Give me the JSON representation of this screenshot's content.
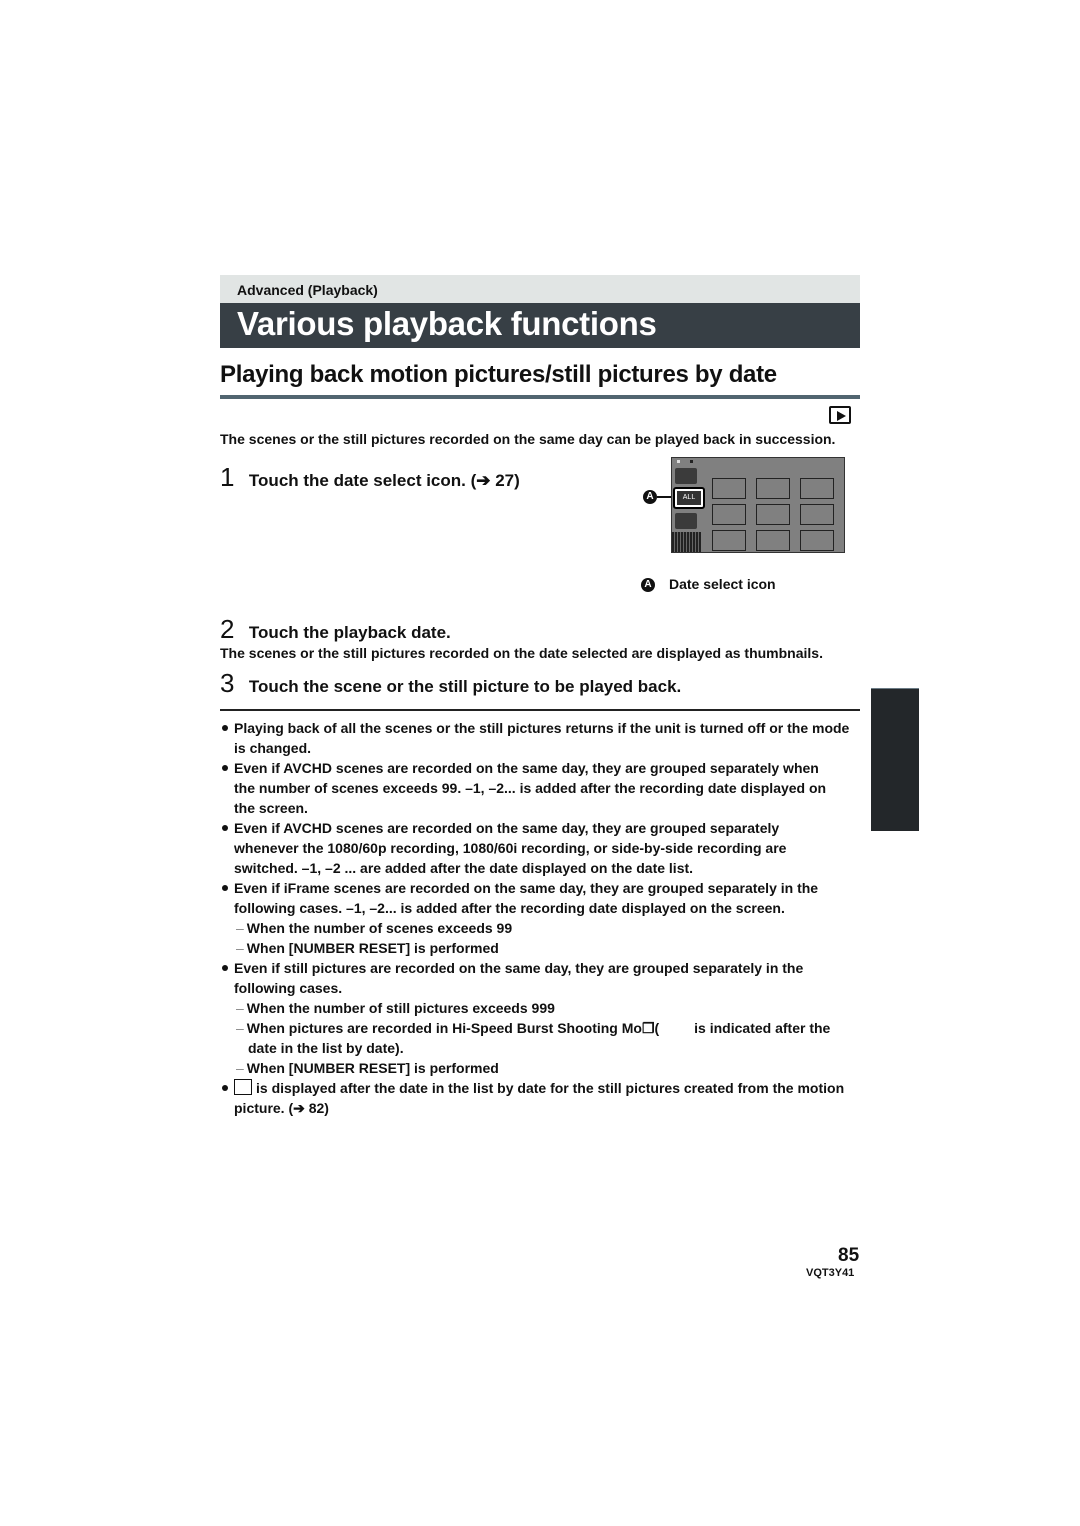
{
  "header": {
    "section_label": "Advanced (Playback)",
    "title": "Various playback functions",
    "subtitle": "Playing back motion pictures/still pictures by date",
    "mode_icon": "playback-mode-icon"
  },
  "intro": "The scenes or the still pictures recorded on the same day can be played back in succession.",
  "steps": [
    {
      "num": "1",
      "text": "Touch the date select icon. (➔ 27)"
    },
    {
      "num": "2",
      "text": "Touch the playback date.",
      "detail": "The scenes or the still pictures recorded on the date selected are displayed as thumbnails."
    },
    {
      "num": "3",
      "text": "Touch the scene or the still picture to be played back."
    }
  ],
  "figure": {
    "marker": "A",
    "all_label": "ALL",
    "caption": "Date select icon",
    "thumbnail_rows": 3,
    "thumbnail_cols": 3
  },
  "notes": [
    {
      "type": "bullet",
      "text": "Playing back of all the scenes or the still pictures returns if the unit is turned off or the mode"
    },
    {
      "type": "cont",
      "text": "is changed."
    },
    {
      "type": "bullet",
      "text": "Even if AVCHD scenes are recorded on the same day, they are grouped separately when"
    },
    {
      "type": "cont",
      "text": "the number of scenes exceeds 99. –1, –2... is added after the recording date displayed on"
    },
    {
      "type": "cont",
      "text": "the screen."
    },
    {
      "type": "bullet",
      "text": "Even if AVCHD scenes are recorded on the same day, they are grouped separately"
    },
    {
      "type": "cont",
      "text": "whenever the 1080/60p recording, 1080/60i recording, or side-by-side recording are"
    },
    {
      "type": "cont",
      "text": "switched. –1, –2 ... are added after the date displayed on the date list."
    },
    {
      "type": "bullet",
      "text": "Even if iFrame scenes are recorded on the same day, they are grouped separately in the"
    },
    {
      "type": "cont",
      "text": "following cases. –1, –2... is added after the recording date displayed on the screen."
    },
    {
      "type": "dash",
      "text": "When the number of scenes exceeds 99"
    },
    {
      "type": "dash",
      "text": "When [NUMBER RESET] is performed"
    },
    {
      "type": "bullet",
      "text": "Even if still pictures are recorded on the same day, they are grouped separately in the"
    },
    {
      "type": "cont",
      "text": "following cases."
    },
    {
      "type": "dash",
      "text": "When the number of still pictures exceeds 999"
    },
    {
      "type": "dash",
      "text": "When pictures are recorded in Hi-Speed Burst Shooting Mo❐(         is indicated after the"
    },
    {
      "type": "cont2",
      "text": "date in the list by date)."
    },
    {
      "type": "dash",
      "text": "When [NUMBER RESET] is performed"
    },
    {
      "type": "bullet-icon",
      "text": "is displayed after the date in the list by date for the still pictures created from the motion"
    },
    {
      "type": "cont",
      "text": "picture. (➔ 82)"
    }
  ],
  "footer": {
    "page_number": "85",
    "doc_code": "VQT3Y41"
  }
}
